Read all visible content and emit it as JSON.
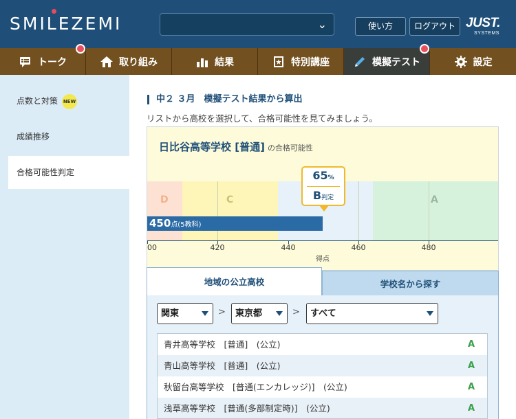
{
  "header": {
    "logo": "SMILEZEMI",
    "usage_label": "使い方",
    "logout_label": "ログアウト",
    "brand": "JUST.",
    "brand_sub": "SYSTEMS"
  },
  "nav": {
    "items": [
      {
        "label": "トーク",
        "icon": "chat-icon"
      },
      {
        "label": "取り組み",
        "icon": "home-icon"
      },
      {
        "label": "結果",
        "icon": "bar-chart-icon"
      },
      {
        "label": "特別講座",
        "icon": "book-icon"
      },
      {
        "label": "模擬テスト",
        "icon": "pencil-icon"
      },
      {
        "label": "設定",
        "icon": "gear-icon"
      }
    ]
  },
  "sidebar": {
    "items": [
      {
        "label": "点数と対策",
        "badge": "NEW"
      },
      {
        "label": "成績推移"
      },
      {
        "label": "合格可能性判定"
      }
    ]
  },
  "main": {
    "section_title": "中２ ３月　模擬テスト結果から算出",
    "subtitle": "リストから高校を選択して、合格可能性を見てみましょう。",
    "school_name": "日比谷高等学校 [普通]",
    "school_suffix": "の合格可能性"
  },
  "chart_data": {
    "type": "bar",
    "title": "日比谷高等学校 [普通]",
    "xlabel": "得点",
    "x_ticks": [
      "00",
      "420",
      "440",
      "460",
      "480"
    ],
    "zones": [
      "D",
      "C",
      "B",
      "A"
    ],
    "score_value": "450",
    "score_unit": "点(5教科)",
    "probability": "65",
    "probability_unit": "%",
    "judgement": "B",
    "judgement_suffix": "判定"
  },
  "tabs": {
    "regional": "地域の公立高校",
    "search": "学校名から探す"
  },
  "filters": {
    "region": "関東",
    "prefecture": "東京都",
    "category": "すべて",
    "separator": ">"
  },
  "schools": [
    {
      "name": "青井高等学校　[普通]　(公立)",
      "grade": "A"
    },
    {
      "name": "青山高等学校　[普通]　(公立)",
      "grade": "A"
    },
    {
      "name": "秋留台高等学校　[普通(エンカレッジ)]　(公立)",
      "grade": "A"
    },
    {
      "name": "浅草高等学校　[普通(多部制定時)]　(公立)",
      "grade": "A"
    }
  ],
  "colors": {
    "header_bg": "#1f4f78",
    "nav_bg": "#73501f",
    "nav_active": "#3a3e3b",
    "accent_red": "#e8505b",
    "score_bar": "#2a6aa5",
    "grade_green": "#3aa04a"
  }
}
